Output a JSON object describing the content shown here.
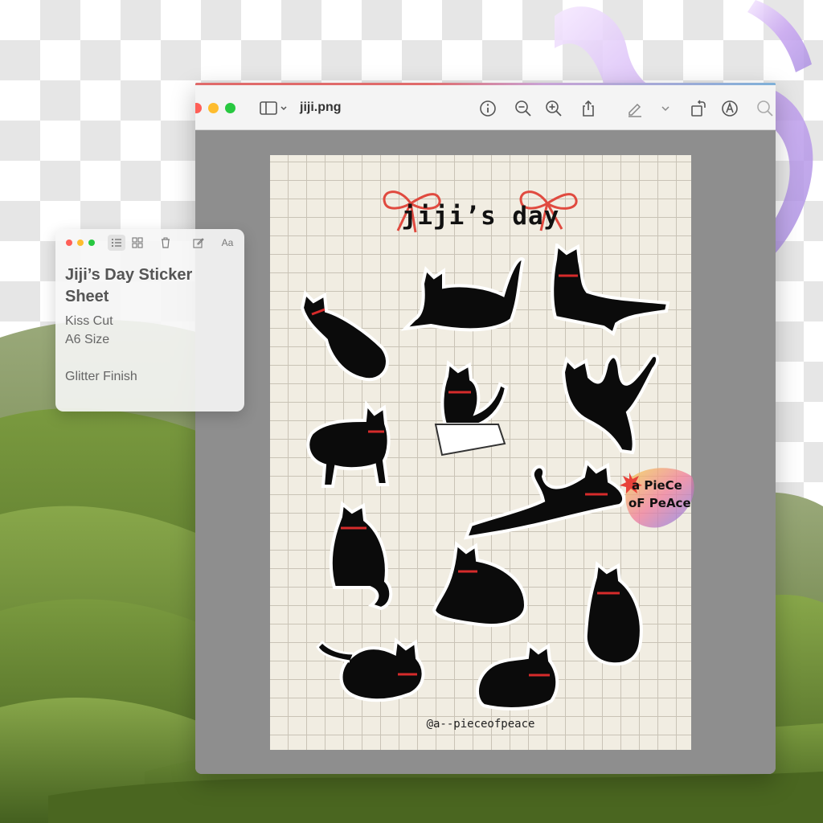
{
  "preview_window": {
    "title": "jiji.png",
    "toolbar_icons": [
      "sidebar-icon",
      "chevron-down-icon",
      "info-icon",
      "zoom-out-icon",
      "zoom-in-icon",
      "share-icon",
      "markup-pen-icon",
      "chevron-down-icon",
      "rotate-icon",
      "annotate-icon",
      "search-icon"
    ]
  },
  "sticker_sheet": {
    "title": "jiji’s day",
    "handle": "@a--pieceofpeace",
    "brand_line1": "a PieCe",
    "brand_line2": "oF PeAce"
  },
  "notes_window": {
    "title": "Jiji’s Day Sticker Sheet",
    "lines": [
      "Kiss Cut",
      "A6 Size",
      "",
      "Glitter Finish"
    ],
    "font_button": "Aa"
  },
  "colors": {
    "bow_red": "#e04a3f",
    "cat_black": "#0b0b0b",
    "collar_red": "#d62b2b",
    "sheet_bg": "#f1ede2",
    "hill_green": "#5c7a2e"
  }
}
